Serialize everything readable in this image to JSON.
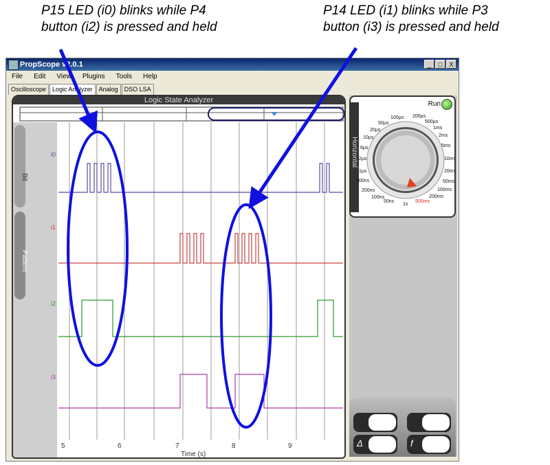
{
  "annotations": [
    {
      "text": "P15 LED (i0) blinks while P4\nbutton (i2) is pressed and held"
    },
    {
      "text": "P14 LED (i1) blinks while P3\nbutton (i3) is pressed and held"
    }
  ],
  "window": {
    "title": "PropScope v2.0.1",
    "buttons": {
      "minimize": "_",
      "maximize": "□",
      "close": "X"
    }
  },
  "menu": [
    "File",
    "Edit",
    "View",
    "Plugins",
    "Tools",
    "Help"
  ],
  "tabs": [
    {
      "label": "Oscilloscope",
      "active": false
    },
    {
      "label": "Logic Analyzer",
      "active": true
    },
    {
      "label": "Analog",
      "active": false
    },
    {
      "label": "DSO LSA",
      "active": false
    }
  ],
  "analyzer": {
    "title": "Logic State Analyzer",
    "side_tabs": {
      "bit": "Bit",
      "pattern": "Pattern"
    },
    "channels": [
      {
        "label": "i0",
        "color": "#5a4aa0"
      },
      {
        "label": "i1",
        "color": "#c84040"
      },
      {
        "label": "i2",
        "color": "#2a9a2a"
      },
      {
        "label": "i3",
        "color": "#b03ab0"
      }
    ],
    "x_ticks": [
      "5",
      "6",
      "7",
      "8",
      "9"
    ],
    "x_label": "Time (s)"
  },
  "horizontal": {
    "label": "Horizontal",
    "run_label": "Run",
    "dial_labels": [
      "100µs",
      "200µs",
      "50µs",
      "500µs",
      "20µs",
      "1ms",
      "10µs",
      "2ms",
      "6µs",
      "5ms",
      "2µs",
      "10ms",
      "1µs",
      "20ms",
      "500ns",
      "50ms",
      "200ns",
      "100ms",
      "100ns",
      "200ms",
      "50ns",
      "1s",
      "500ms"
    ],
    "selected": "500ms"
  },
  "measure": {
    "delta_label": "Δ",
    "freq_label": "f"
  },
  "colors": {
    "arrow": "#1010e0",
    "accent_selected": "#e02020"
  }
}
